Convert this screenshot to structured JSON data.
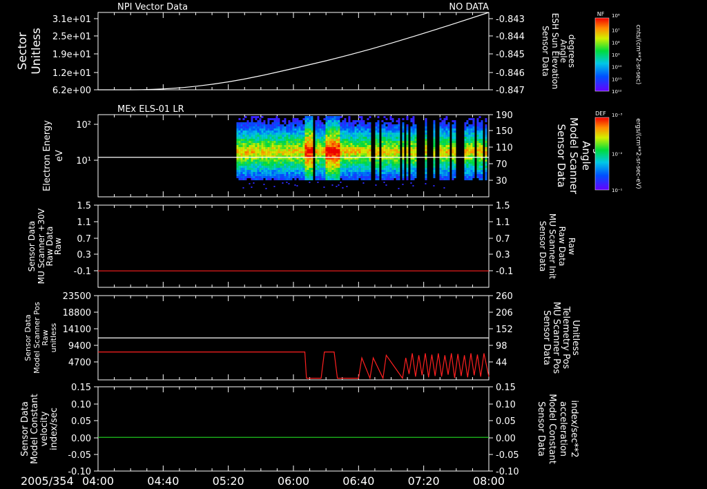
{
  "figure": {
    "date_label": "2005/354",
    "x_ticks": [
      "04:00",
      "04:40",
      "05:20",
      "06:00",
      "06:40",
      "07:20",
      "08:00"
    ]
  },
  "colors": {
    "background": "#000000",
    "axis": "#ffffff",
    "red": "#ff2020",
    "green": "#22dd22"
  },
  "chart_data": [
    {
      "type": "line",
      "title": "NPI Vector Data",
      "status_label": "NO DATA",
      "left_axis": {
        "label": [
          "Sector",
          "Unitless"
        ],
        "ticks": [
          "3.1e+01",
          "2.5e+01",
          "1.9e+01",
          "1.2e+01",
          "6.2e+00"
        ],
        "ylim": [
          6.2,
          31
        ]
      },
      "right_axis": {
        "label": [
          "Sensor Data",
          "ESH Sun Elevation",
          "Angle",
          "degrees"
        ],
        "ticks": [
          "-0.843",
          "-0.844",
          "-0.845",
          "-0.846",
          "-0.847"
        ],
        "ylim": [
          -0.8474,
          -0.843
        ]
      },
      "colorbar": {
        "title": "NF",
        "label": "cnts/(cm**2-sr-sec)",
        "ticks": [
          "10¹²",
          "10¹¹",
          "10¹⁰",
          "10⁹",
          "10⁸",
          "10⁷",
          "10⁶"
        ]
      },
      "series": [
        {
          "axis": "right",
          "color": "#ffffff",
          "x": [
            "04:00",
            "04:40",
            "05:20",
            "06:00",
            "06:40",
            "07:20",
            "08:00"
          ],
          "values": [
            -0.8474,
            -0.8474,
            -0.847,
            -0.8462,
            -0.8453,
            -0.8442,
            -0.843
          ]
        }
      ]
    },
    {
      "type": "heatmap",
      "title": "MEx ELS-01 LR",
      "left_axis": {
        "label": [
          "Electron Energy",
          "eV"
        ],
        "ticks": [
          "10²",
          "10¹"
        ],
        "scale": "log"
      },
      "right_axis": {
        "label": [
          "Sensor Data",
          "Model Scanner",
          "Angle",
          "degrees"
        ],
        "ticks": [
          "190",
          "150",
          "110",
          "70",
          "30"
        ],
        "ylim": [
          5,
          190
        ]
      },
      "colorbar": {
        "title": "DEF",
        "label": "ergs/(cm**2-sr-sec-eV)",
        "ticks": [
          "10⁻¹",
          "10⁻²",
          "10⁻³"
        ]
      },
      "data_start": "05:25",
      "data_end": "08:00",
      "reference_line": {
        "axis": "right",
        "value": 94,
        "color": "#ffffff"
      }
    },
    {
      "type": "line",
      "left_axis": {
        "label": [
          "Sensor Data",
          "MU Scanner +30V",
          "Raw Data",
          "Raw"
        ],
        "ticks": [
          "1.5",
          "1.1",
          "0.7",
          "0.3",
          "-0.1"
        ],
        "ylim": [
          -0.5,
          1.5
        ]
      },
      "right_axis": {
        "label": [
          "Sensor Data",
          "MU Scanner Init",
          "Raw Data",
          "Raw"
        ],
        "label_color": "#ff2020",
        "ticks": [
          "1.5",
          "1.1",
          "0.7",
          "0.3",
          "-0.1"
        ],
        "ylim": [
          -0.5,
          1.5
        ]
      },
      "series": [
        {
          "axis": "right",
          "color": "#ff2020",
          "x": [
            "04:00",
            "08:00"
          ],
          "values": [
            -0.1,
            -0.1
          ]
        }
      ]
    },
    {
      "type": "line",
      "left_axis": {
        "label": [
          "Sensor Data",
          "Model Scanner Pos",
          "Raw",
          "unitless"
        ],
        "ticks": [
          "23500",
          "18800",
          "14100",
          "9400",
          "4700"
        ],
        "ylim": [
          0,
          23500
        ]
      },
      "right_axis": {
        "label": [
          "Sensor Data",
          "MU Scanner Pos",
          "Telemetry Pos",
          "Unitless"
        ],
        "label_color": "#ff2020",
        "ticks": [
          "260",
          "206",
          "152",
          "98",
          "44"
        ],
        "ylim": [
          0,
          260
        ]
      },
      "series": [
        {
          "axis": "left",
          "color": "#ffffff",
          "x": [
            "04:00",
            "08:00"
          ],
          "values": [
            11700,
            11700
          ]
        },
        {
          "axis": "right",
          "color": "#ff2020",
          "x": [
            "04:00",
            "06:07",
            "06:08",
            "06:17",
            "06:19",
            "06:25",
            "06:27",
            "06:40",
            "06:42",
            "06:47",
            "06:49",
            "06:55",
            "06:57",
            "07:07",
            "07:09",
            "07:11",
            "07:13",
            "07:15",
            "07:17",
            "07:19",
            "07:21",
            "07:23",
            "07:25",
            "07:27",
            "07:29",
            "07:31",
            "07:33",
            "07:35",
            "07:37",
            "07:39",
            "07:41",
            "07:43",
            "07:45",
            "07:47",
            "07:49",
            "07:51",
            "07:53",
            "07:55",
            "07:57",
            "08:00"
          ],
          "values": [
            86,
            86,
            5,
            5,
            86,
            86,
            5,
            5,
            68,
            5,
            68,
            5,
            76,
            5,
            68,
            18,
            82,
            10,
            76,
            14,
            82,
            8,
            78,
            12,
            82,
            10,
            76,
            16,
            82,
            6,
            80,
            12,
            76,
            8,
            82,
            14,
            78,
            10,
            82,
            10
          ]
        }
      ]
    },
    {
      "type": "line",
      "left_axis": {
        "label": [
          "Sensor Data",
          "Model Constant",
          "velocity",
          "index/sec"
        ],
        "ticks": [
          "0.15",
          "0.10",
          "0.05",
          "0.00",
          "-0.05",
          "-0.10"
        ],
        "ylim": [
          -0.1,
          0.15
        ]
      },
      "right_axis": {
        "label": [
          "Sensor Data",
          "Model Constant",
          "acceleration",
          "index/sec**2"
        ],
        "label_color": "#22dd22",
        "ticks": [
          "0.15",
          "0.10",
          "0.05",
          "0.00",
          "-0.05",
          "-0.10"
        ],
        "ylim": [
          -0.1,
          0.15
        ]
      },
      "series": [
        {
          "axis": "right",
          "color": "#22dd22",
          "x": [
            "04:00",
            "08:00"
          ],
          "values": [
            0.0,
            0.0
          ]
        }
      ]
    }
  ]
}
